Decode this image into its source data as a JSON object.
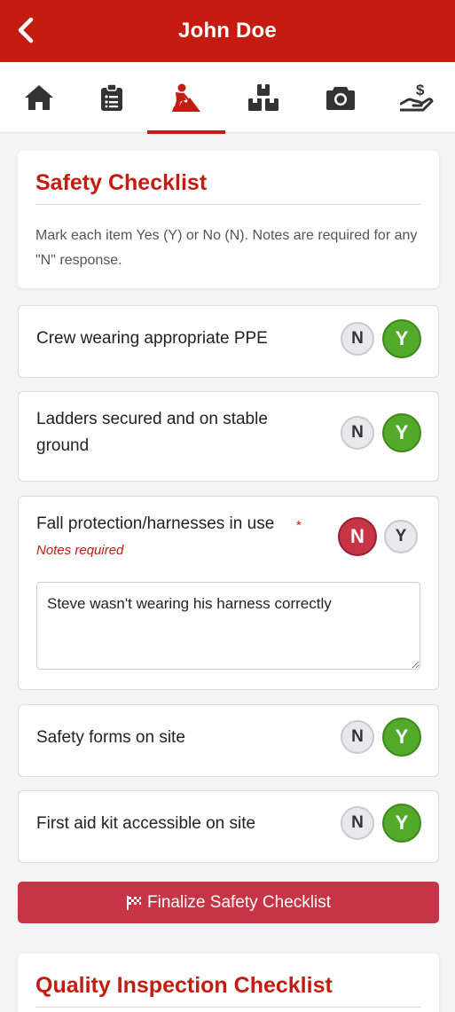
{
  "header": {
    "title": "John Doe"
  },
  "tabs": [
    {
      "icon": "home-icon"
    },
    {
      "icon": "clipboard-icon"
    },
    {
      "icon": "worker-digging-icon",
      "active": true
    },
    {
      "icon": "boxes-icon"
    },
    {
      "icon": "camera-icon"
    },
    {
      "icon": "hand-dollar-icon"
    }
  ],
  "safety": {
    "title": "Safety Checklist",
    "instructions": "Mark each item Yes (Y) or No (N). Notes are required for any \"N\" response.",
    "items": [
      {
        "label": "Crew wearing appropriate PPE",
        "value": "Y"
      },
      {
        "label": "Ladders secured and on stable ground",
        "value": "Y"
      },
      {
        "label": "Fall protection/harnesses in use",
        "value": "N",
        "required_marker": "*",
        "notes_required": "Notes required",
        "notes": "Steve wasn't wearing his harness correctly"
      },
      {
        "label": "Safety forms on site",
        "value": "Y"
      },
      {
        "label": "First aid kit accessible on site",
        "value": "Y"
      }
    ],
    "toggle_no": "N",
    "toggle_yes": "Y",
    "finalize_label": "Finalize Safety Checklist"
  },
  "quality": {
    "title": "Quality Inspection Checklist"
  },
  "colors": {
    "brand": "#c41c10",
    "yes": "#53a929",
    "no": "#c63445"
  }
}
